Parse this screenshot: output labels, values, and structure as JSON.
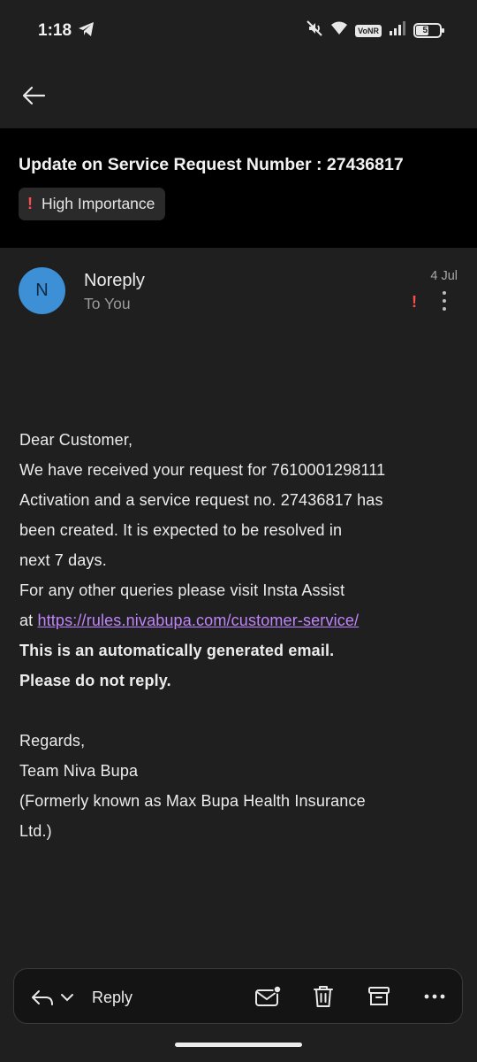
{
  "status_bar": {
    "time": "1:18",
    "volte_label": "VoNR",
    "battery_level": "51"
  },
  "email": {
    "subject": "Update on Service Request Number : 27436817",
    "importance_label": "High Importance",
    "sender": {
      "initial": "N",
      "name": "Noreply",
      "recipient": "To You",
      "date": "4 Jul"
    },
    "body": {
      "greeting": "Dear Customer,",
      "line1": "We have received your request for 7610001298111",
      "line2": "Activation and a service request no. 27436817 has",
      "line3": "been created. It is expected to be resolved in",
      "line4": "next 7 days.",
      "line5": "For any other queries please visit Insta Assist",
      "at_prefix": "at ",
      "link": "https://rules.nivabupa.com/customer-service/",
      "bold_line1": "This is an automatically generated email.",
      "bold_line2": "Please do not reply.",
      "regards": "Regards,",
      "team": "Team Niva Bupa",
      "formerly1": "(Formerly known as Max Bupa Health Insurance",
      "formerly2": "Ltd.)"
    }
  },
  "actions": {
    "reply_label": "Reply"
  },
  "colors": {
    "accent_link": "#c084fc",
    "importance_red": "#ff4d4f",
    "avatar_blue": "#3d8fd6"
  }
}
